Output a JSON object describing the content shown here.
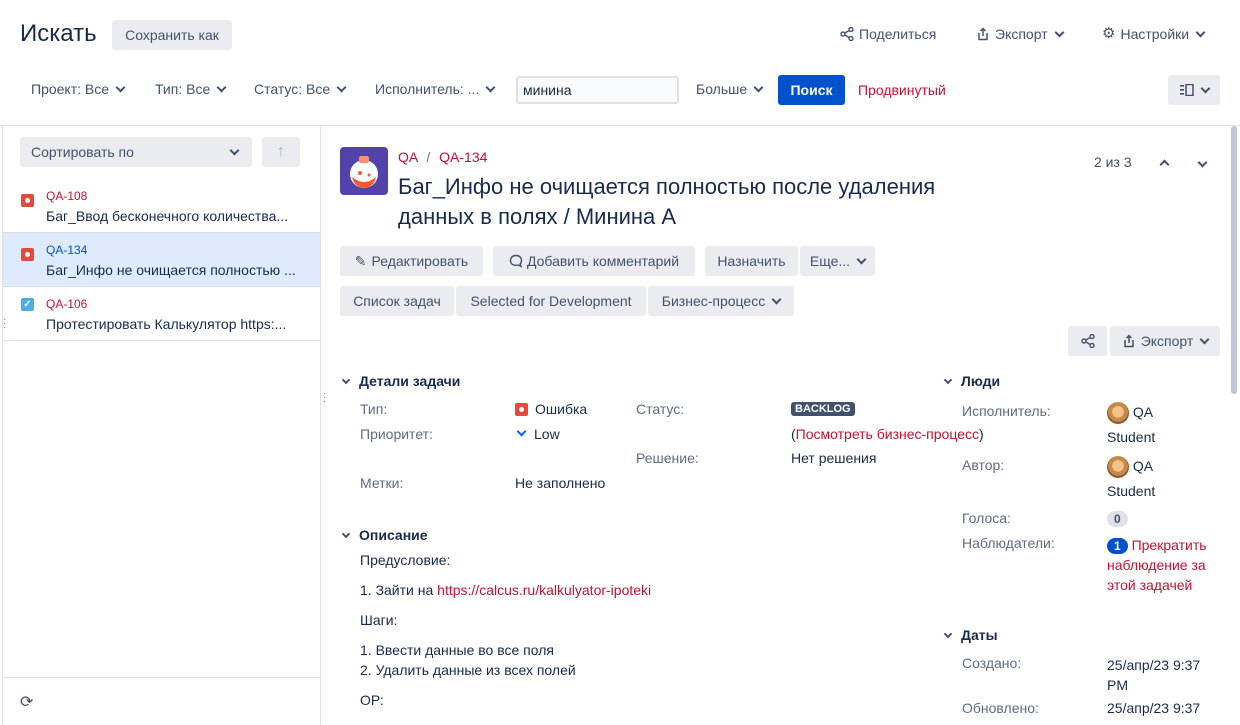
{
  "header": {
    "title": "Искать",
    "save_as": "Сохранить как",
    "share": "Поделиться",
    "export": "Экспорт",
    "settings": "Настройки"
  },
  "filters": {
    "project": "Проект: Все",
    "type": "Тип: Все",
    "status": "Статус: Все",
    "assignee": "Исполнитель: ...",
    "search_value": "минина",
    "more": "Больше",
    "search_button": "Поиск",
    "advanced": "Продвинутый"
  },
  "sidebar": {
    "sort_label": "Сортировать по",
    "items": [
      {
        "key": "QA-108",
        "summary": "Баг_Ввод бесконечного количества...",
        "type": "bug",
        "selected": false
      },
      {
        "key": "QA-134",
        "summary": "Баг_Инфо не очищается полностью ...",
        "type": "bug",
        "selected": true
      },
      {
        "key": "QA-106",
        "summary": "Протестировать Калькулятор https:...",
        "type": "task",
        "selected": false
      }
    ]
  },
  "issue": {
    "project": "QA",
    "key": "QA-134",
    "title_line1": "Баг_Инфо не очищается полностью после удаления",
    "title_line2": "данных в полях / Минина А",
    "pager": "2 из 3",
    "actions": {
      "edit": "Редактировать",
      "comment": "Добавить комментарий",
      "assign": "Назначить",
      "more": "Еще...",
      "todo": "Список задач",
      "selected_dev": "Selected for Development",
      "workflow": "Бизнес-процесс",
      "export": "Экспорт"
    },
    "details": {
      "heading": "Детали задачи",
      "type_label": "Тип:",
      "type_value": "Ошибка",
      "priority_label": "Приоритет:",
      "priority_value": "Low",
      "labels_label": "Метки:",
      "labels_value": "Не заполнено",
      "status_label": "Статус:",
      "status_value": "BACKLOG",
      "workflow_open": "(",
      "workflow_link": "Посмотреть бизнес-процесс",
      "workflow_close": ")",
      "resolution_label": "Решение:",
      "resolution_value": "Нет решения"
    },
    "description": {
      "heading": "Описание",
      "precondition": "Предусловие:",
      "step0_prefix": "1. Зайти на ",
      "step0_link": "https://calcus.ru/kalkulyator-ipoteki",
      "steps_label": "Шаги:",
      "step1": "1. Ввести данные во все поля",
      "step2": "2. Удалить данные из всех полей",
      "or_label": "ОР:"
    },
    "people": {
      "heading": "Люди",
      "assignee_label": "Исполнитель:",
      "assignee_line1": "QA",
      "assignee_line2": "Student",
      "reporter_label": "Автор:",
      "reporter_line1": "QA",
      "reporter_line2": "Student",
      "votes_label": "Голоса:",
      "votes_value": "0",
      "watchers_label": "Наблюдатели:",
      "watchers_value": "1",
      "watch_line1": "Прекратить",
      "watch_line2": "наблюдение за",
      "watch_line3": "этой задачей"
    },
    "dates": {
      "heading": "Даты",
      "created_label": "Создано:",
      "created_line1": "25/апр/23 9:37",
      "created_line2": "PM",
      "updated_label": "Обновлено:",
      "updated_line1": "25/апр/23 9:37"
    }
  },
  "colors": {
    "accent_blue": "#0052cc",
    "link_red": "#c9102f",
    "selected_row": "#deebff"
  }
}
